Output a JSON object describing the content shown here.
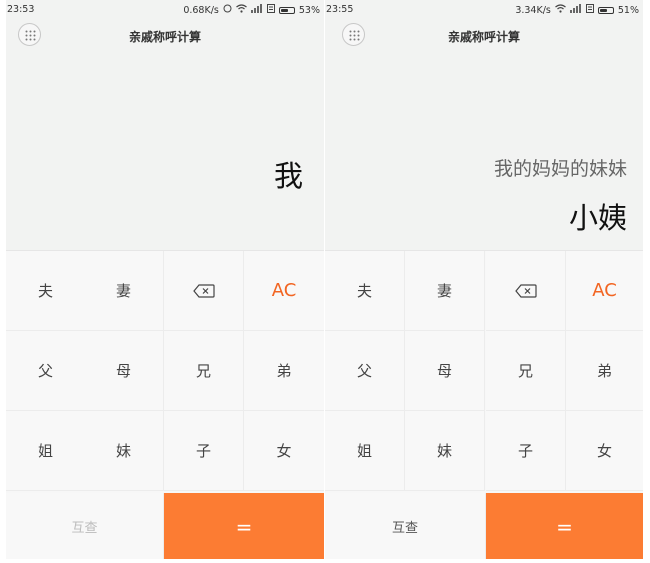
{
  "screens": [
    {
      "status": {
        "time": "23:53",
        "net_speed": "0.68K/s",
        "battery": "53%",
        "battery_level": 0.53
      },
      "title": "亲戚称呼计算",
      "display": {
        "expression": "",
        "result": "我"
      },
      "keys": {
        "row1": [
          "夫",
          "妻",
          "",
          "AC"
        ],
        "row2": [
          "父",
          "母",
          "兄",
          "弟"
        ],
        "row3": [
          "姐",
          "妹",
          "子",
          "女"
        ],
        "check": "互查",
        "equals": "="
      }
    },
    {
      "status": {
        "time": "23:55",
        "net_speed": "3.34K/s",
        "battery": "51%",
        "battery_level": 0.51
      },
      "title": "亲戚称呼计算",
      "display": {
        "expression": "我的妈妈的妹妹",
        "result": "小姨"
      },
      "keys": {
        "row1": [
          "夫",
          "妻",
          "",
          "AC"
        ],
        "row2": [
          "父",
          "母",
          "兄",
          "弟"
        ],
        "row3": [
          "姐",
          "妹",
          "子",
          "女"
        ],
        "check": "互查",
        "equals": "="
      }
    }
  ],
  "colors": {
    "accent": "#fc7c33",
    "ac_text": "#f26522",
    "display_bg": "#f2f3f2",
    "keypad_bg": "#f8f8f8"
  },
  "icons": {
    "menu": "grid-dots-icon",
    "backspace": "backspace-icon",
    "wifi": "wifi-icon",
    "signal": "signal-icon",
    "alarm": "alarm-icon",
    "battery": "battery-icon"
  }
}
